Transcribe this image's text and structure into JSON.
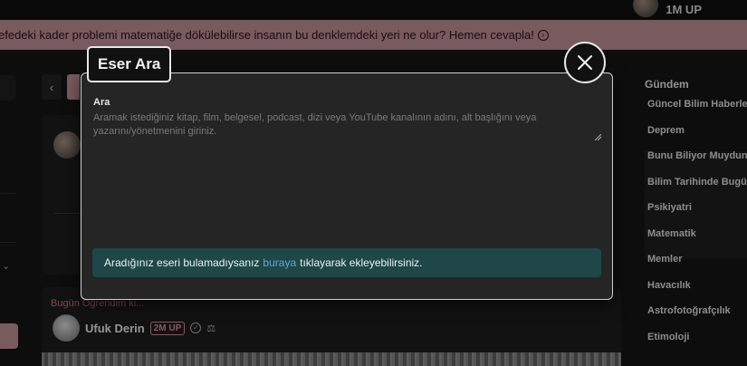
{
  "topbar": {
    "user_badge": "1M UP"
  },
  "banner": {
    "text": "efedeki kader problemi matematiğe dökülebilirse insanın bu denklemdeki yeri ne olur? Hemen cevapla!"
  },
  "post": {
    "tag": "Bugün Öğrendim ki...",
    "author": "Ufuk Derin",
    "author_badge": "2M UP"
  },
  "sidebar": {
    "title": "Gündem",
    "items": [
      "Güncel Bilim Haberleri",
      "Deprem",
      "Bunu Biliyor Muydunuz",
      "Bilim Tarihinde Bugün",
      "Psikiyatri",
      "Matematik",
      "Memler",
      "Havacılık",
      "Astrofotoğrafçılık",
      "Etimoloji"
    ]
  },
  "modal": {
    "title": "Eser Ara",
    "field_label": "Ara",
    "field_placeholder": "Aramak istediğiniz kitap, film, belgesel, podcast, dizi veya YouTube kanalının adını, alt başlığını veya yazarını/yönetmenini giriniz.",
    "notice_before": "Aradığınız eseri bulamadıysanız",
    "notice_link": "buraya",
    "notice_after": "tıklayarak ekleyebilirsiniz."
  },
  "colors": {
    "banner_bg": "#b88a93",
    "notice_bg": "#1f4747",
    "link": "#5ca8e0",
    "accent_pink": "#d08a96"
  }
}
